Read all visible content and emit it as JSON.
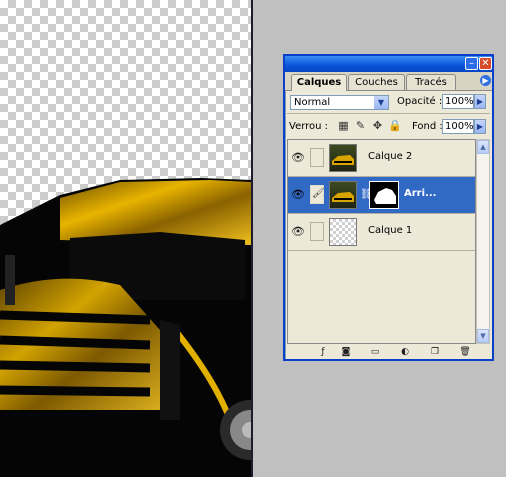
{
  "palette": {
    "tabs": [
      "Calques",
      "Couches",
      "Tracés"
    ],
    "blend_mode": "Normal",
    "opacity_label": "Opacité :",
    "opacity_value": "100%",
    "lock_label": "Verrou :",
    "fill_label": "Fond :",
    "fill_value": "100%",
    "layers": [
      {
        "name": "Calque 2",
        "visible": true,
        "selected": false,
        "thumbnail": "car"
      },
      {
        "name": "Arri...",
        "visible": true,
        "selected": true,
        "thumbnail": "car",
        "has_mask": true
      },
      {
        "name": "Calque 1",
        "visible": true,
        "selected": false,
        "thumbnail": "transparent"
      }
    ]
  },
  "colors": {
    "selection": "#316ac5",
    "titlebar": "#0853d9",
    "car_yellow": "#e0b000",
    "canvas_bg": "#c0c0c0"
  }
}
